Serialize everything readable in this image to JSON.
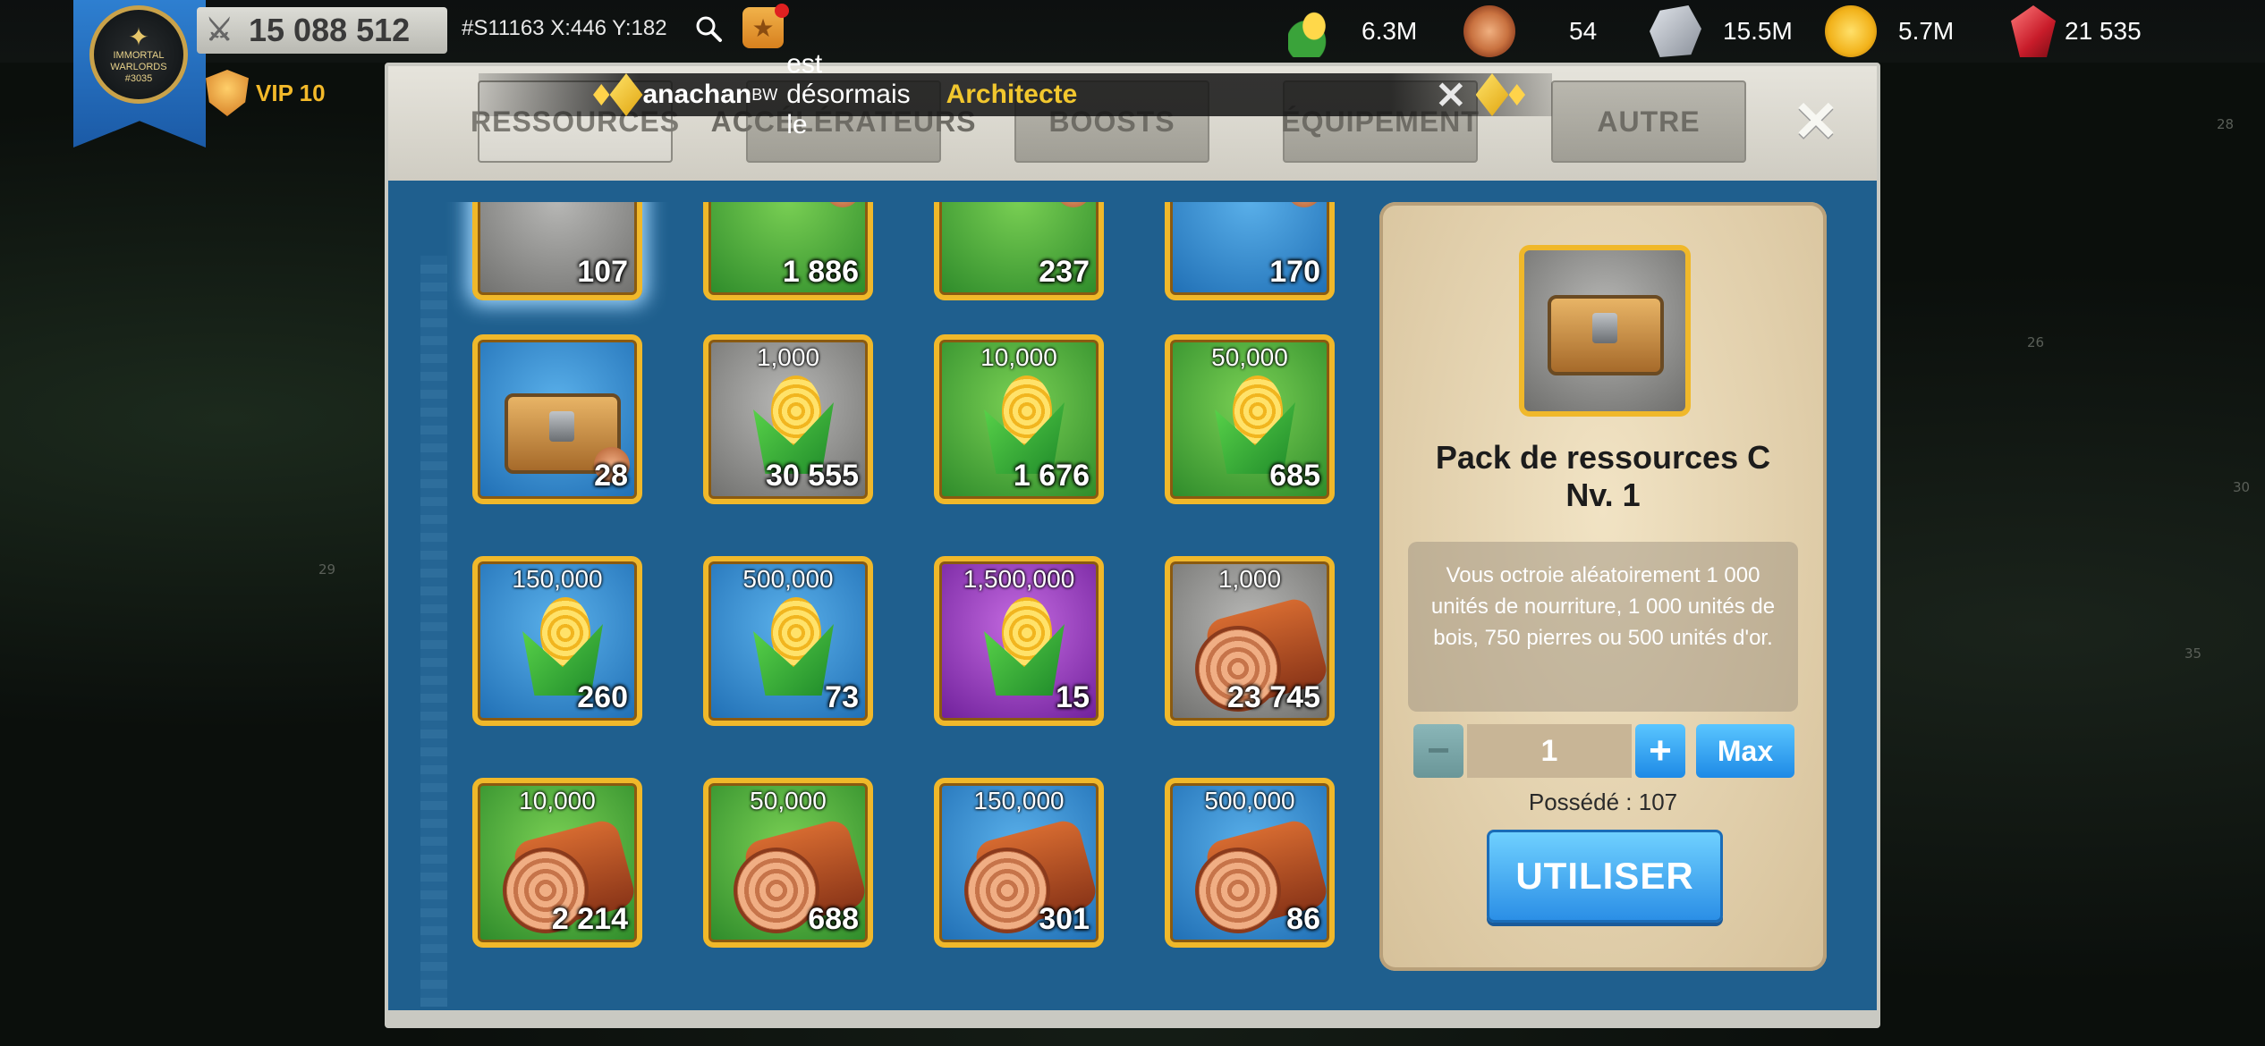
{
  "topbar": {
    "badge_text": "IMMORTAL WARLORDS",
    "badge_sub": "#3035",
    "power": "15 088 512",
    "vip": "VIP 10",
    "coords": "#S11163 X:446 Y:182",
    "resources": {
      "food": "6.3M",
      "wood": "54",
      "stone": "15.5M",
      "gold": "5.7M",
      "gems": "21 535"
    }
  },
  "notification": {
    "name": "anachan",
    "tag": "BW",
    "middle": "est désormais le",
    "role": "Architecte"
  },
  "tabs": [
    {
      "label": "RESSOURCES"
    },
    {
      "label": "ACCÉLÉRATEURS"
    },
    {
      "label": "BOOSTS"
    },
    {
      "label": "ÉQUIPEMENT"
    },
    {
      "label": "AUTRE"
    }
  ],
  "items": [
    {
      "label": "",
      "count": "107",
      "kind": "chest",
      "bg": "grey"
    },
    {
      "label": "",
      "count": "1 886",
      "kind": "chest",
      "bg": "green"
    },
    {
      "label": "",
      "count": "237",
      "kind": "chest",
      "bg": "green"
    },
    {
      "label": "",
      "count": "170",
      "kind": "chest",
      "bg": "blue"
    },
    {
      "label": "",
      "count": "28",
      "kind": "chest",
      "bg": "blue"
    },
    {
      "label": "1,000",
      "count": "30 555",
      "kind": "corn",
      "bg": "grey"
    },
    {
      "label": "10,000",
      "count": "1 676",
      "kind": "corn",
      "bg": "green"
    },
    {
      "label": "50,000",
      "count": "685",
      "kind": "corn",
      "bg": "green"
    },
    {
      "label": "150,000",
      "count": "260",
      "kind": "corn",
      "bg": "blue"
    },
    {
      "label": "500,000",
      "count": "73",
      "kind": "corn",
      "bg": "blue"
    },
    {
      "label": "1,500,000",
      "count": "15",
      "kind": "corn",
      "bg": "purple"
    },
    {
      "label": "1,000",
      "count": "23 745",
      "kind": "log",
      "bg": "grey"
    },
    {
      "label": "10,000",
      "count": "2 214",
      "kind": "log",
      "bg": "green"
    },
    {
      "label": "50,000",
      "count": "688",
      "kind": "log",
      "bg": "green"
    },
    {
      "label": "150,000",
      "count": "301",
      "kind": "log",
      "bg": "blue"
    },
    {
      "label": "500,000",
      "count": "86",
      "kind": "log",
      "bg": "blue"
    }
  ],
  "detail": {
    "title_line1": "Pack de ressources C",
    "title_line2": "Nv. 1",
    "description": "Vous octroie aléatoirement 1 000 unités de nourriture, 1 000 unités de bois, 750 pierres ou 500 unités d'or.",
    "quantity": "1",
    "max_label": "Max",
    "owned": "Possédé : 107",
    "use_label": "UTILISER"
  },
  "map_numbers": [
    "28",
    "26",
    "30",
    "29",
    "35"
  ]
}
